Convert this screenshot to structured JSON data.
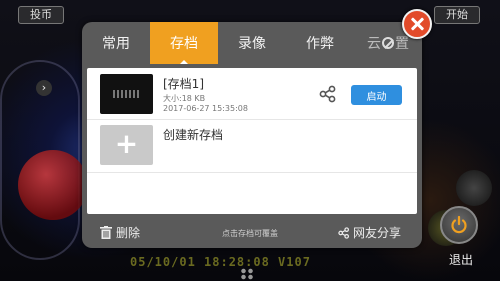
{
  "background": {
    "left_button": "投币",
    "right_button": "开始",
    "bottom_text": "05/10/01 18:28:08 V107"
  },
  "tabs": [
    {
      "label": "常用"
    },
    {
      "label": "存档"
    },
    {
      "label": "录像"
    },
    {
      "label": "作弊"
    },
    {
      "label_a": "云",
      "label_b": "置"
    }
  ],
  "active_tab": "存档",
  "saves": [
    {
      "title": "[存档1]",
      "size": "大小:18 KB",
      "time": "2017-06-27 15:35:08",
      "launch_label": "启动"
    }
  ],
  "new_save_label": "创建新存档",
  "footer": {
    "delete_label": "删除",
    "hint": "点击存档可覆盖",
    "share_label": "网友分享"
  },
  "exit_label": "退出",
  "colors": {
    "tab_active": "#f0a020",
    "launch_button": "#2f8fdf",
    "close_button": "#e24b2a"
  },
  "icons": [
    "close-icon",
    "share-icon",
    "trash-icon",
    "power-icon",
    "plus-icon",
    "no-sign-icon",
    "chevron-left-icon"
  ]
}
